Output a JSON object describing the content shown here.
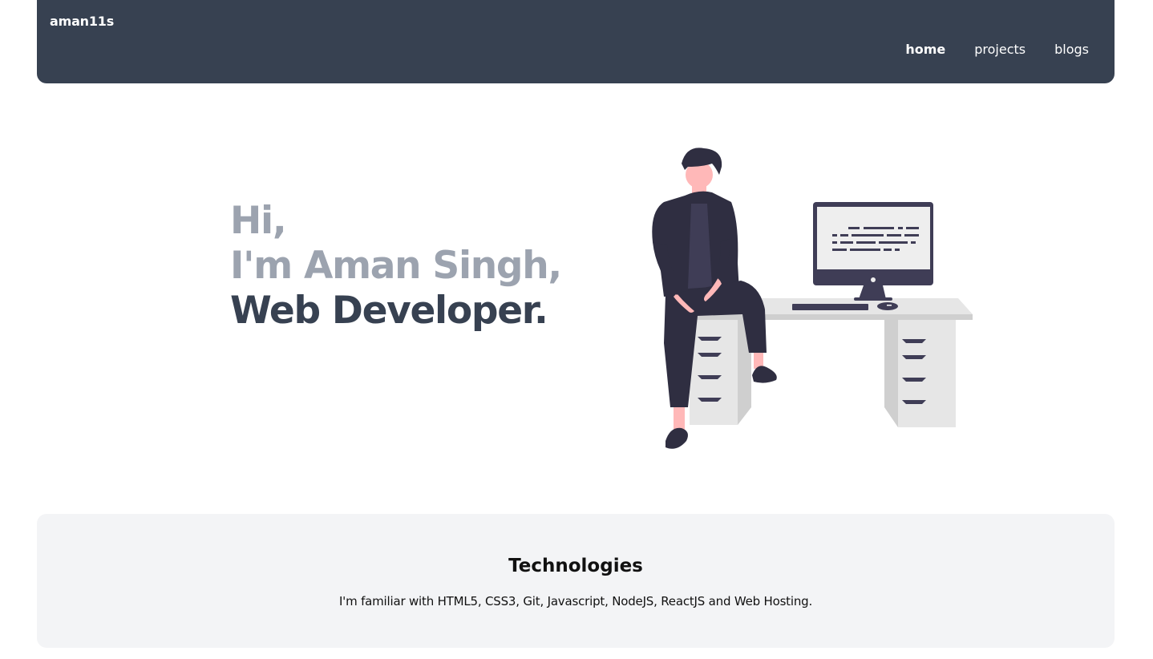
{
  "header": {
    "brand": "aman11s",
    "nav": [
      {
        "label": "home",
        "active": true
      },
      {
        "label": "projects",
        "active": false
      },
      {
        "label": "blogs",
        "active": false
      }
    ]
  },
  "hero": {
    "greeting": "Hi,",
    "name_line": "I'm Aman Singh,",
    "role_line": "Web Developer."
  },
  "illustration": {
    "icon": "developer-at-desk-illustration"
  },
  "technologies": {
    "title": "Technologies",
    "description": "I'm familiar with HTML5, CSS3, Git, Javascript, NodeJS, ReactJS and Web Hosting."
  },
  "colors": {
    "navbar": "#374151",
    "hero_muted": "#9ca3af",
    "hero_strong": "#374151",
    "card_bg": "#f3f4f6"
  }
}
